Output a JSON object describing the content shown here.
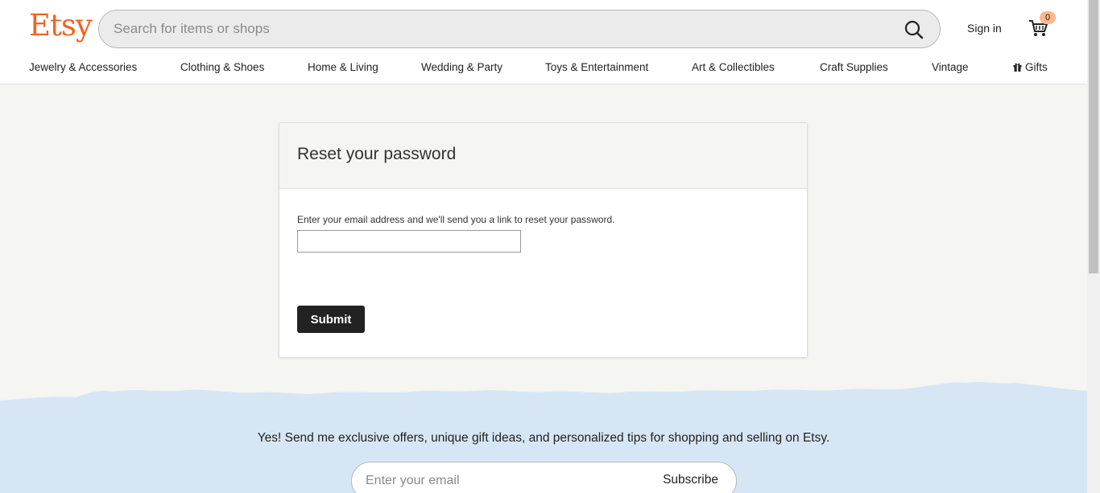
{
  "header": {
    "logo": "Etsy",
    "search_placeholder": "Search for items or shops",
    "sign_in": "Sign in",
    "cart_count": "0"
  },
  "nav": {
    "items": [
      "Jewelry & Accessories",
      "Clothing & Shoes",
      "Home & Living",
      "Wedding & Party",
      "Toys & Entertainment",
      "Art & Collectibles",
      "Craft Supplies",
      "Vintage",
      "Gifts"
    ]
  },
  "reset": {
    "title": "Reset your password",
    "description": "Enter your email address and we'll send you a link to reset your password.",
    "email_value": "",
    "submit_label": "Submit"
  },
  "footer": {
    "promo": "Yes! Send me exclusive offers, unique gift ideas, and personalized tips for shopping and selling on Etsy.",
    "email_placeholder": "Enter your email",
    "subscribe_label": "Subscribe"
  },
  "colors": {
    "brand": "#f1641e",
    "page_bg": "#f5f5f1",
    "footer_bg": "#d7e6f5",
    "button_bg": "#222222",
    "cart_badge": "#fdb78f"
  }
}
